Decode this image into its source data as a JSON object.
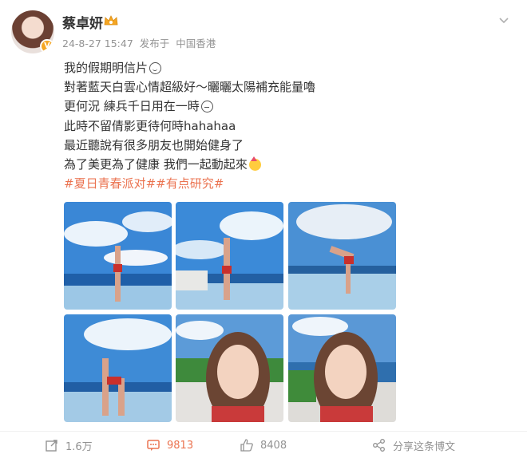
{
  "author": {
    "name": "蔡卓妍",
    "verified_badge": "V"
  },
  "meta": {
    "timestamp": "24-8-27 15:47",
    "posted_from_label": "发布于",
    "location": "中国香港"
  },
  "post": {
    "lines": [
      "我的假期明信片",
      "對著藍天白雲心情超級好～曬曬太陽補充能量嚕",
      "更何況  練兵千日用在一時",
      "此時不留倩影更待何時hahahaa",
      "最近聽說有很多朋友也開始健身了",
      "為了美更為了健康 我們一起動起來"
    ],
    "topics": "#夏日青春派对##有点研究#",
    "line_emojis": [
      "smile-emoji",
      "",
      "sweat-emoji",
      "",
      "",
      "party-emoji"
    ]
  },
  "images": [
    {
      "label": "photo-1"
    },
    {
      "label": "photo-2"
    },
    {
      "label": "photo-3"
    },
    {
      "label": "photo-4"
    },
    {
      "label": "photo-5"
    },
    {
      "label": "photo-6"
    }
  ],
  "actions": {
    "repost_count": "1.6万",
    "comment_count": "9813",
    "like_count": "8408",
    "share_label": "分享这条博文"
  },
  "colors": {
    "accent": "#eb7350",
    "meta_gray": "#939393",
    "text": "#333333"
  }
}
